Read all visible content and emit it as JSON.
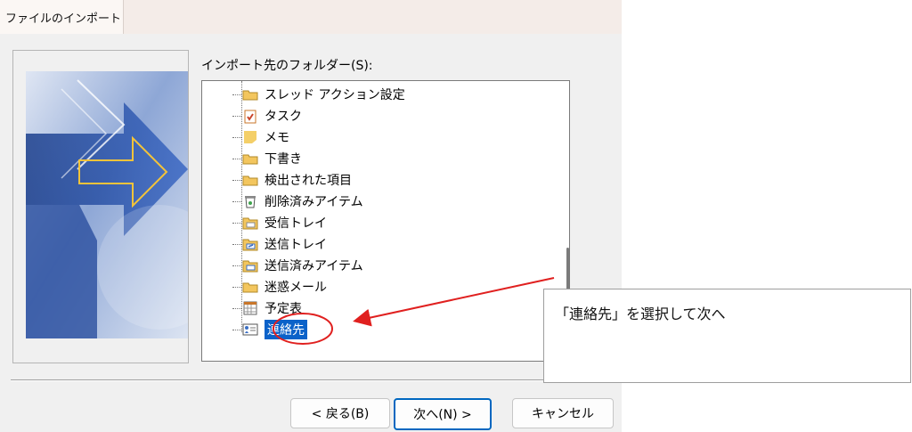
{
  "title": "ファイルのインポート",
  "folder_label": "インポート先のフォルダー(S):",
  "tree_items": [
    {
      "label": "スレッド アクション設定",
      "icon": "folder-icon"
    },
    {
      "label": "タスク",
      "icon": "task-icon"
    },
    {
      "label": "メモ",
      "icon": "note-icon"
    },
    {
      "label": "下書き",
      "icon": "folder-icon"
    },
    {
      "label": "検出された項目",
      "icon": "folder-icon"
    },
    {
      "label": "削除済みアイテム",
      "icon": "trash-icon"
    },
    {
      "label": "受信トレイ",
      "icon": "inbox-icon"
    },
    {
      "label": "送信トレイ",
      "icon": "outbox-icon"
    },
    {
      "label": "送信済みアイテム",
      "icon": "sent-icon"
    },
    {
      "label": "迷惑メール",
      "icon": "folder-icon"
    },
    {
      "label": "予定表",
      "icon": "calendar-icon"
    },
    {
      "label": "連絡先",
      "icon": "contacts-icon",
      "selected": true
    }
  ],
  "buttons": {
    "back": "< 戻る(B)",
    "next": "次へ(N) >",
    "cancel": "キャンセル"
  },
  "annotation": "「連絡先」を選択して次へ",
  "colors": {
    "selection": "#0b62c9",
    "annotation_red": "#e0201f",
    "primary_border": "#0067c0"
  }
}
